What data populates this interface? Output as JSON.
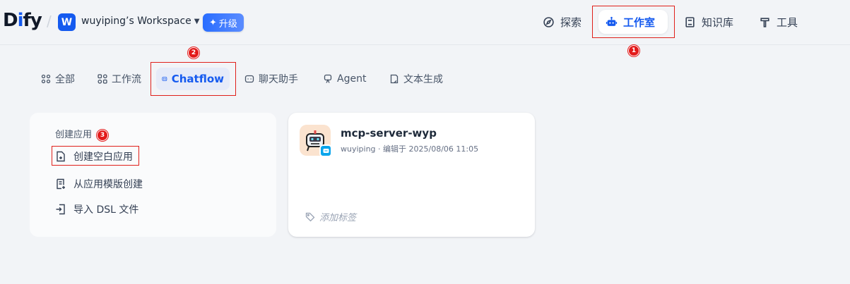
{
  "header": {
    "logo_prefix": "D",
    "logo_i": "i",
    "logo_suffix": "fy",
    "workspace_initial": "W",
    "workspace_name": "wuyiping’s Workspace",
    "upgrade_label": "升级",
    "nav": {
      "explore": "探索",
      "studio": "工作室",
      "knowledge": "知识库",
      "tools": "工具"
    }
  },
  "tabs": {
    "all": "全部",
    "workflow": "工作流",
    "chatflow": "Chatflow",
    "chat": "聊天助手",
    "agent": "Agent",
    "text": "文本生成"
  },
  "create": {
    "title": "创建应用",
    "blank": "创建空白应用",
    "template": "从应用模版创建",
    "dsl": "导入 DSL 文件"
  },
  "app": {
    "name": "mcp-server-wyp",
    "meta": "wuyiping · 编辑于 2025/08/06 11:05",
    "tag_placeholder": "添加标签"
  },
  "markers": [
    "1",
    "2",
    "3"
  ],
  "colors": {
    "accent": "#155aef",
    "annotation": "#e0201a"
  }
}
